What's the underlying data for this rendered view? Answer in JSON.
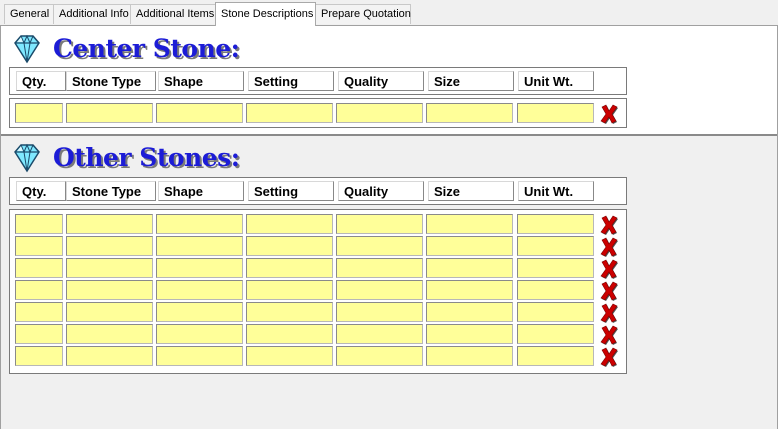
{
  "tabs": [
    {
      "label": "General",
      "active": false
    },
    {
      "label": "Additional Info",
      "active": false
    },
    {
      "label": "Additional Items",
      "active": false
    },
    {
      "label": "Stone Descriptions",
      "active": true
    },
    {
      "label": "Prepare Quotation",
      "active": false
    }
  ],
  "center": {
    "title": "Center Stone:",
    "gem_icon": "diamond-icon",
    "headers": [
      "Qty.",
      "Stone Type",
      "Shape",
      "Setting",
      "Quality",
      "Size",
      "Unit Wt."
    ],
    "rows": [
      {
        "values": [
          "",
          "",
          "",
          "",
          "",
          "",
          ""
        ]
      }
    ]
  },
  "other": {
    "title": "Other Stones:",
    "gem_icon": "diamond-icon",
    "headers": [
      "Qty.",
      "Stone Type",
      "Shape",
      "Setting",
      "Quality",
      "Size",
      "Unit Wt."
    ],
    "rows": [
      {
        "values": [
          "",
          "",
          "",
          "",
          "",
          "",
          ""
        ]
      },
      {
        "values": [
          "",
          "",
          "",
          "",
          "",
          "",
          ""
        ]
      },
      {
        "values": [
          "",
          "",
          "",
          "",
          "",
          "",
          ""
        ]
      },
      {
        "values": [
          "",
          "",
          "",
          "",
          "",
          "",
          ""
        ]
      },
      {
        "values": [
          "",
          "",
          "",
          "",
          "",
          "",
          ""
        ]
      },
      {
        "values": [
          "",
          "",
          "",
          "",
          "",
          "",
          ""
        ]
      },
      {
        "values": [
          "",
          "",
          "",
          "",
          "",
          "",
          ""
        ]
      }
    ]
  },
  "colors": {
    "field_bg": "#ffff99",
    "title": "#1c1cd6",
    "delete": "#cc0000"
  },
  "delete_icon": "delete-x-icon"
}
